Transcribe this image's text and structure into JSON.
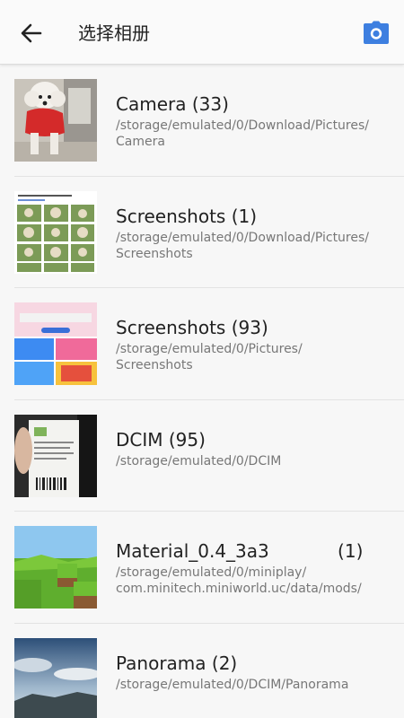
{
  "header": {
    "title": "选择相册",
    "back_icon": "arrow-left-icon",
    "camera_icon": "camera-icon",
    "accent_color": "#3d7fe0"
  },
  "albums": [
    {
      "name": "Camera (33)",
      "path": "/storage/emulated/0/Download/Pictures/\nCamera",
      "thumb": "dog-photo"
    },
    {
      "name": "Screenshots (1)",
      "path": "/storage/emulated/0/Download/Pictures/\nScreenshots",
      "thumb": "food-grid-screenshot"
    },
    {
      "name": "Screenshots (93)",
      "path": "/storage/emulated/0/Pictures/\nScreenshots",
      "thumb": "app-screenshot"
    },
    {
      "name": "DCIM (95)",
      "path": "/storage/emulated/0/DCIM",
      "thumb": "receipt-photo"
    },
    {
      "name": "Material_0.4_3a3            (1)",
      "path": "/storage/emulated/0/miniplay/\ncom.minitech.miniworld.uc/data/mods/",
      "thumb": "blocky-game-world"
    },
    {
      "name": "Panorama (2)",
      "path": "/storage/emulated/0/DCIM/Panorama",
      "thumb": "sky-landscape"
    }
  ]
}
